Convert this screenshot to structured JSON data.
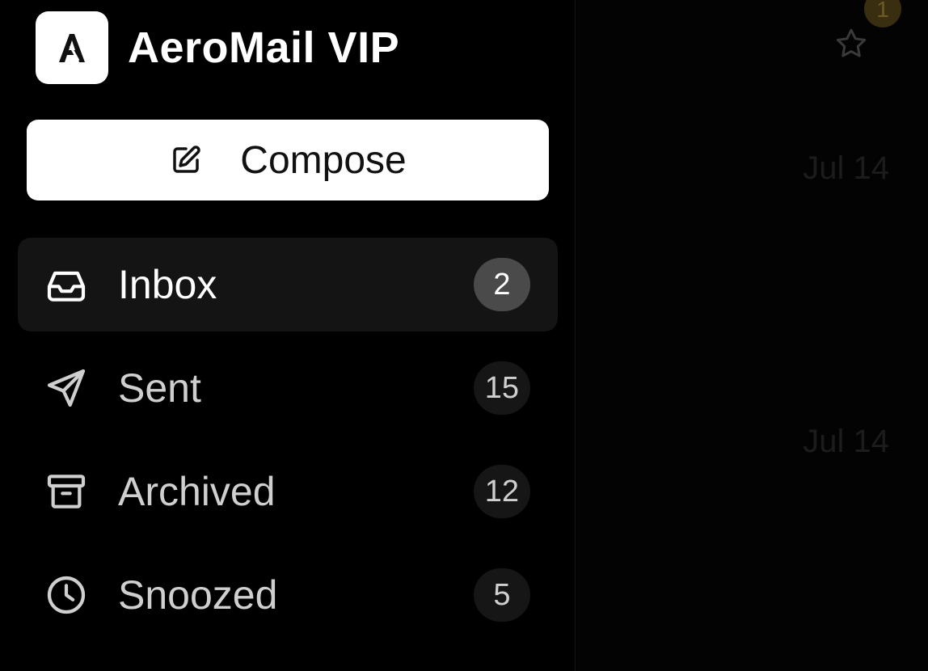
{
  "brand": {
    "logo_letter": "A",
    "name": "AeroMail VIP"
  },
  "compose": {
    "label": "Compose",
    "icon": "edit-icon"
  },
  "nav": {
    "items": [
      {
        "label": "Inbox",
        "count": "2",
        "icon": "inbox-icon",
        "active": true
      },
      {
        "label": "Sent",
        "count": "15",
        "icon": "send-icon",
        "active": false
      },
      {
        "label": "Archived",
        "count": "12",
        "icon": "archive-icon",
        "active": false
      },
      {
        "label": "Snoozed",
        "count": "5",
        "icon": "clock-icon",
        "active": false
      }
    ]
  },
  "list": {
    "notification_count": "1",
    "dates": [
      "Jul 14",
      "Jul 14"
    ]
  },
  "colors": {
    "background": "#000000",
    "active_item": "#141414",
    "active_badge": "#4a4a4a",
    "compose_bg": "#ffffff",
    "notification_badge": "#3a2e10"
  }
}
